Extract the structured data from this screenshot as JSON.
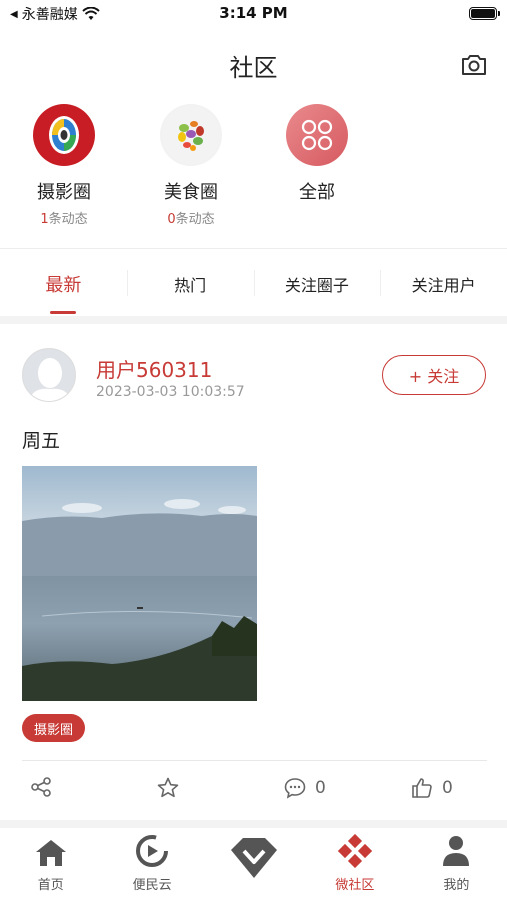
{
  "status_bar": {
    "carrier": "永善融媒",
    "time": "3:14 PM"
  },
  "header": {
    "title": "社区"
  },
  "circles": [
    {
      "name": "摄影圈",
      "count": "1",
      "count_suffix": "条动态"
    },
    {
      "name": "美食圈",
      "count": "0",
      "count_suffix": "条动态"
    },
    {
      "name": "全部"
    }
  ],
  "tabs": [
    {
      "label": "最新",
      "active": true
    },
    {
      "label": "热门"
    },
    {
      "label": "关注圈子"
    },
    {
      "label": "关注用户"
    }
  ],
  "post": {
    "username": "用户560311",
    "time": "2023-03-03 10:03:57",
    "follow_label": "+ 关注",
    "content": "周五",
    "tag": "摄影圈",
    "comment_count": "0",
    "like_count": "0"
  },
  "nav": [
    {
      "label": "首页",
      "icon": "home-icon"
    },
    {
      "label": "便民云",
      "icon": "cloud-service-icon"
    },
    {
      "label": "",
      "icon": "center-logo-icon"
    },
    {
      "label": "微社区",
      "icon": "community-icon",
      "active": true
    },
    {
      "label": "我的",
      "icon": "profile-icon"
    }
  ],
  "colors": {
    "accent": "#c73a35",
    "muted": "#999999"
  }
}
